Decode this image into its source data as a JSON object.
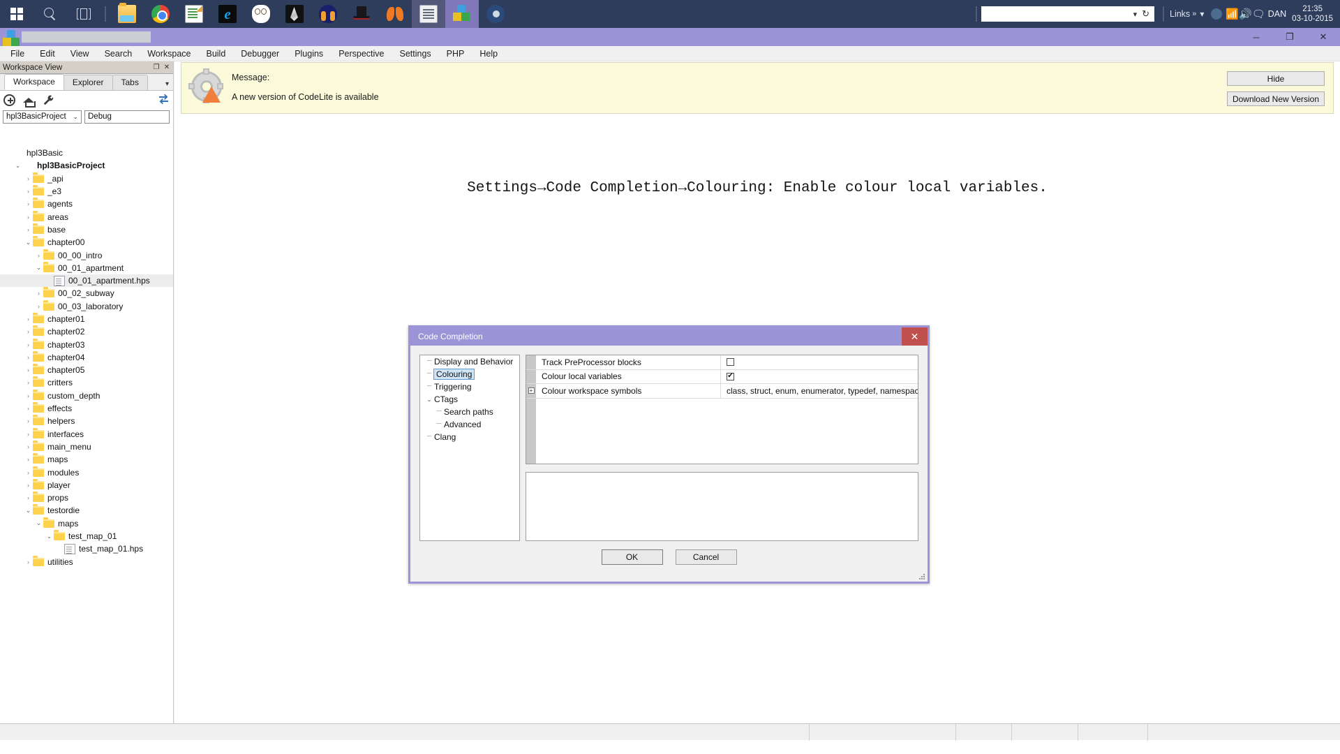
{
  "taskbar": {
    "start_icon": "windows-logo-icon",
    "search_icon": "search-icon",
    "taskview_icon": "task-view-icon",
    "pinned_apps": [
      {
        "name": "file-explorer",
        "icon": "folder-icon"
      },
      {
        "name": "google-chrome",
        "icon": "chrome-icon"
      },
      {
        "name": "notepad-plus-plus",
        "icon": "notepad-icon"
      },
      {
        "name": "internet-explorer",
        "icon": "internet-explorer-icon"
      },
      {
        "name": "gimp",
        "icon": "gimp-icon"
      },
      {
        "name": "inkscape",
        "icon": "inkscape-icon"
      },
      {
        "name": "audacity",
        "icon": "headphones-icon"
      },
      {
        "name": "tophat-app",
        "icon": "top-hat-icon"
      },
      {
        "name": "butterfly-app",
        "icon": "butterfly-icon"
      },
      {
        "name": "text-document",
        "icon": "document-icon"
      },
      {
        "name": "codelite",
        "icon": "codelite-cubes-icon"
      },
      {
        "name": "steam",
        "icon": "steam-icon"
      }
    ],
    "address_value": "",
    "address_placeholder": "",
    "address_caret_icon": "chevron-down-icon",
    "address_reload_icon": "reload-icon",
    "links_label": "Links",
    "links_overflow": "»",
    "tray_chevron_icon": "chevron-up-icon",
    "tray_icons": [
      "steam-tray-icon",
      "wifi-icon",
      "volume-icon",
      "action-center-icon"
    ],
    "user": "DAN",
    "time": "21:35",
    "date": "03-10-2015"
  },
  "window": {
    "title": "",
    "icon": "codelite-cubes-icon",
    "minimize_label": "─",
    "maximize_label": "❐",
    "close_label": "✕"
  },
  "menubar": {
    "items": [
      "File",
      "Edit",
      "View",
      "Search",
      "Workspace",
      "Build",
      "Debugger",
      "Plugins",
      "Perspective",
      "Settings",
      "PHP",
      "Help"
    ]
  },
  "workspace_panel": {
    "caption": "Workspace View",
    "caption_restore": "❐",
    "caption_close": "✕",
    "tabs": [
      {
        "label": "Workspace",
        "active": true
      },
      {
        "label": "Explorer",
        "active": false
      },
      {
        "label": "Tabs",
        "active": false
      }
    ],
    "tabs_overflow_icon": "chevron-down-icon",
    "toolbar": [
      {
        "name": "add-icon"
      },
      {
        "name": "home-icon"
      },
      {
        "name": "wrench-icon"
      }
    ],
    "toolbar_right_icon": "link-editor-icon",
    "project_select": {
      "value": "hpl3BasicProject",
      "caret": "⌄"
    },
    "config_select": {
      "value": "Debug",
      "caret": "⌄"
    },
    "tree": [
      {
        "indent": 0,
        "arrow": "none",
        "icon": "workspace",
        "label": "hpl3Basic",
        "bold": false,
        "selected": false
      },
      {
        "indent": 1,
        "arrow": "open",
        "icon": "project",
        "label": "hpl3BasicProject",
        "bold": true,
        "selected": false
      },
      {
        "indent": 2,
        "arrow": "closed",
        "icon": "folder",
        "label": "_api",
        "bold": false,
        "selected": false
      },
      {
        "indent": 2,
        "arrow": "closed",
        "icon": "folder",
        "label": "_e3",
        "bold": false,
        "selected": false
      },
      {
        "indent": 2,
        "arrow": "closed",
        "icon": "folder",
        "label": "agents",
        "bold": false,
        "selected": false
      },
      {
        "indent": 2,
        "arrow": "closed",
        "icon": "folder",
        "label": "areas",
        "bold": false,
        "selected": false
      },
      {
        "indent": 2,
        "arrow": "closed",
        "icon": "folder",
        "label": "base",
        "bold": false,
        "selected": false
      },
      {
        "indent": 2,
        "arrow": "open",
        "icon": "folder",
        "label": "chapter00",
        "bold": false,
        "selected": false
      },
      {
        "indent": 3,
        "arrow": "closed",
        "icon": "folder",
        "label": "00_00_intro",
        "bold": false,
        "selected": false
      },
      {
        "indent": 3,
        "arrow": "open",
        "icon": "folder",
        "label": "00_01_apartment",
        "bold": false,
        "selected": false
      },
      {
        "indent": 4,
        "arrow": "none",
        "icon": "file",
        "label": "00_01_apartment.hps",
        "bold": false,
        "selected": true
      },
      {
        "indent": 3,
        "arrow": "closed",
        "icon": "folder",
        "label": "00_02_subway",
        "bold": false,
        "selected": false
      },
      {
        "indent": 3,
        "arrow": "closed",
        "icon": "folder",
        "label": "00_03_laboratory",
        "bold": false,
        "selected": false
      },
      {
        "indent": 2,
        "arrow": "closed",
        "icon": "folder",
        "label": "chapter01",
        "bold": false,
        "selected": false
      },
      {
        "indent": 2,
        "arrow": "closed",
        "icon": "folder",
        "label": "chapter02",
        "bold": false,
        "selected": false
      },
      {
        "indent": 2,
        "arrow": "closed",
        "icon": "folder",
        "label": "chapter03",
        "bold": false,
        "selected": false
      },
      {
        "indent": 2,
        "arrow": "closed",
        "icon": "folder",
        "label": "chapter04",
        "bold": false,
        "selected": false
      },
      {
        "indent": 2,
        "arrow": "closed",
        "icon": "folder",
        "label": "chapter05",
        "bold": false,
        "selected": false
      },
      {
        "indent": 2,
        "arrow": "closed",
        "icon": "folder",
        "label": "critters",
        "bold": false,
        "selected": false
      },
      {
        "indent": 2,
        "arrow": "closed",
        "icon": "folder",
        "label": "custom_depth",
        "bold": false,
        "selected": false
      },
      {
        "indent": 2,
        "arrow": "closed",
        "icon": "folder",
        "label": "effects",
        "bold": false,
        "selected": false
      },
      {
        "indent": 2,
        "arrow": "closed",
        "icon": "folder",
        "label": "helpers",
        "bold": false,
        "selected": false
      },
      {
        "indent": 2,
        "arrow": "closed",
        "icon": "folder",
        "label": "interfaces",
        "bold": false,
        "selected": false
      },
      {
        "indent": 2,
        "arrow": "closed",
        "icon": "folder",
        "label": "main_menu",
        "bold": false,
        "selected": false
      },
      {
        "indent": 2,
        "arrow": "closed",
        "icon": "folder",
        "label": "maps",
        "bold": false,
        "selected": false
      },
      {
        "indent": 2,
        "arrow": "closed",
        "icon": "folder",
        "label": "modules",
        "bold": false,
        "selected": false
      },
      {
        "indent": 2,
        "arrow": "closed",
        "icon": "folder",
        "label": "player",
        "bold": false,
        "selected": false
      },
      {
        "indent": 2,
        "arrow": "closed",
        "icon": "folder",
        "label": "props",
        "bold": false,
        "selected": false
      },
      {
        "indent": 2,
        "arrow": "open",
        "icon": "folder",
        "label": "testordie",
        "bold": false,
        "selected": false
      },
      {
        "indent": 3,
        "arrow": "open",
        "icon": "folder",
        "label": "maps",
        "bold": false,
        "selected": false
      },
      {
        "indent": 4,
        "arrow": "open",
        "icon": "folder",
        "label": "test_map_01",
        "bold": false,
        "selected": false
      },
      {
        "indent": 5,
        "arrow": "none",
        "icon": "file",
        "label": "test_map_01.hps",
        "bold": false,
        "selected": false
      },
      {
        "indent": 2,
        "arrow": "closed",
        "icon": "folder",
        "label": "utilities",
        "bold": false,
        "selected": false
      }
    ]
  },
  "message_bar": {
    "icon": "gear-warning-icon",
    "label": "Message:",
    "text": "A new version of CodeLite is available",
    "hide_button": "Hide",
    "download_button": "Download New Version"
  },
  "overlay_note": {
    "text": "Settings→Code Completion→Colouring: Enable colour local variables."
  },
  "dialog": {
    "title": "Code Completion",
    "close_label": "✕",
    "tree": [
      {
        "indent": 0,
        "prefix": "dash",
        "label": "Display and Behavior",
        "selected": false,
        "caret": ""
      },
      {
        "indent": 0,
        "prefix": "dash",
        "label": "Colouring",
        "selected": true,
        "caret": ""
      },
      {
        "indent": 0,
        "prefix": "dash",
        "label": "Triggering",
        "selected": false,
        "caret": ""
      },
      {
        "indent": 0,
        "prefix": "caret",
        "label": "CTags",
        "selected": false,
        "caret": "⌄"
      },
      {
        "indent": 1,
        "prefix": "dash",
        "label": "Search paths",
        "selected": false,
        "caret": ""
      },
      {
        "indent": 1,
        "prefix": "dash",
        "label": "Advanced",
        "selected": false,
        "caret": ""
      },
      {
        "indent": 0,
        "prefix": "dash",
        "label": "Clang",
        "selected": false,
        "caret": ""
      }
    ],
    "properties": [
      {
        "name": "Track PreProcessor blocks",
        "type": "checkbox",
        "checked": false,
        "expandable": false,
        "value": ""
      },
      {
        "name": "Colour local variables",
        "type": "checkbox",
        "checked": true,
        "expandable": false,
        "value": ""
      },
      {
        "name": "Colour workspace symbols",
        "type": "text",
        "checked": false,
        "expandable": true,
        "expand_glyph": "+",
        "value": "class, struct, enum, enumerator, typedef, namespace"
      }
    ],
    "description_text": "",
    "ok_button": "OK",
    "cancel_button": "Cancel"
  },
  "statusbar": {
    "cells": [
      "",
      "",
      "",
      "",
      ""
    ]
  },
  "colors": {
    "taskbar_bg": "#2e3d5c",
    "title_bg": "#9b95d8",
    "dialog_accent": "#9b95d8",
    "close_red": "#c0504d",
    "message_bg": "#fbfbdb",
    "selection_blue": "#cfe4f7",
    "folder_yellow": "#ffd24d"
  }
}
